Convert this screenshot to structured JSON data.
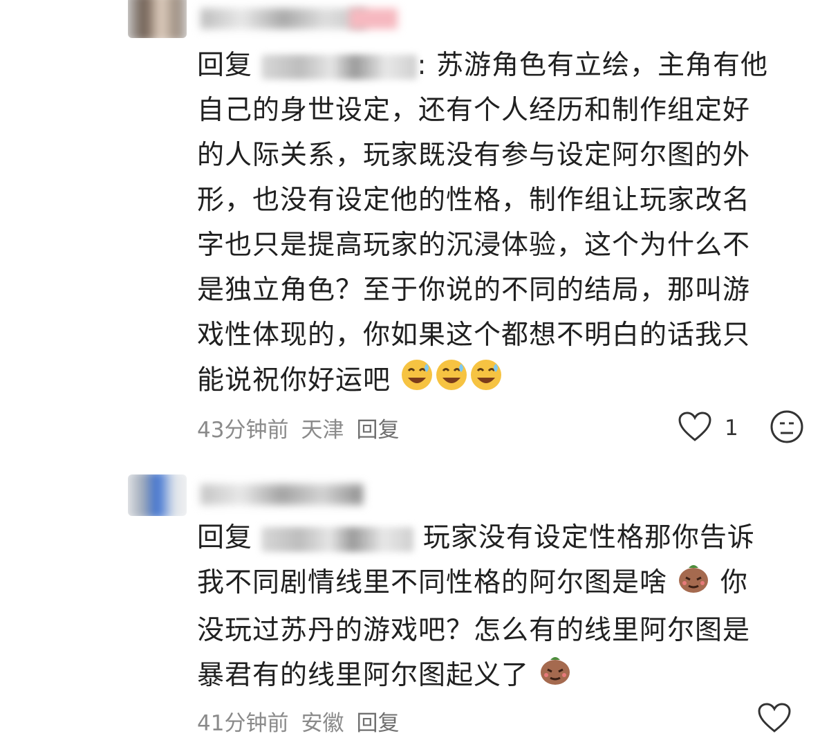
{
  "comments": [
    {
      "reply_prefix": "回复",
      "reply_colon": ":",
      "text": "苏游角色有立绘，主角有他自己的身世设定，还有个人经历和制作组定好的人际关系，玩家既没有参与设定阿尔图的外形，也没有设定他的性格，制作组让玩家改名字也只是提高玩家的沉浸体验，这个为什么不是独立角色？至于你说的不同的结局，那叫游戏性体现的，你如果这个都想不明白的话我只能说祝你好运吧",
      "emoji": "sweat-smile",
      "time": "43分钟前",
      "location": "天津",
      "reply_label": "回复",
      "likes": "1"
    },
    {
      "reply_prefix": "回复",
      "text": "玩家没有设定性格那你告诉我不同剧情线里不同性格的阿尔图是啥",
      "text2": "你没玩过苏丹的游戏吧？怎么有的线里阿尔图是暴君有的线里阿尔图起义了",
      "emoji": "confused-potato",
      "time": "41分钟前",
      "location": "安徽",
      "reply_label": "回复"
    }
  ]
}
